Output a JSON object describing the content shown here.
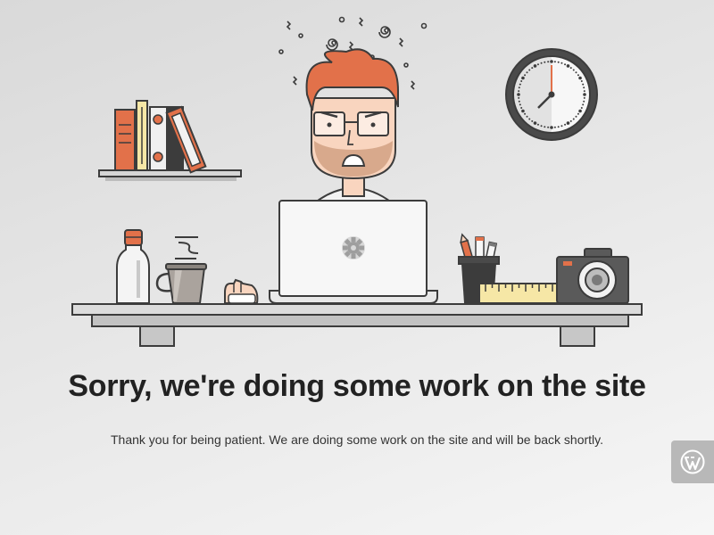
{
  "page": {
    "heading": "Sorry, we're doing some work on the site",
    "message": "Thank you for being patient. We are doing some work on the site and will be back shortly."
  },
  "illustration": {
    "elements": [
      "bookshelf",
      "books",
      "wall-clock",
      "developer",
      "laptop",
      "water-bottle",
      "coffee-cup",
      "pencil-cup",
      "ruler",
      "camera",
      "desk"
    ],
    "icons": [
      "gear-icon",
      "wordpress-icon"
    ]
  },
  "wordpress_badge": {
    "icon": "wordpress-icon"
  },
  "colors": {
    "accent": "#e2714a",
    "heading": "#222222",
    "outline": "#3c3c3c",
    "badge": "#b8b8b8"
  }
}
